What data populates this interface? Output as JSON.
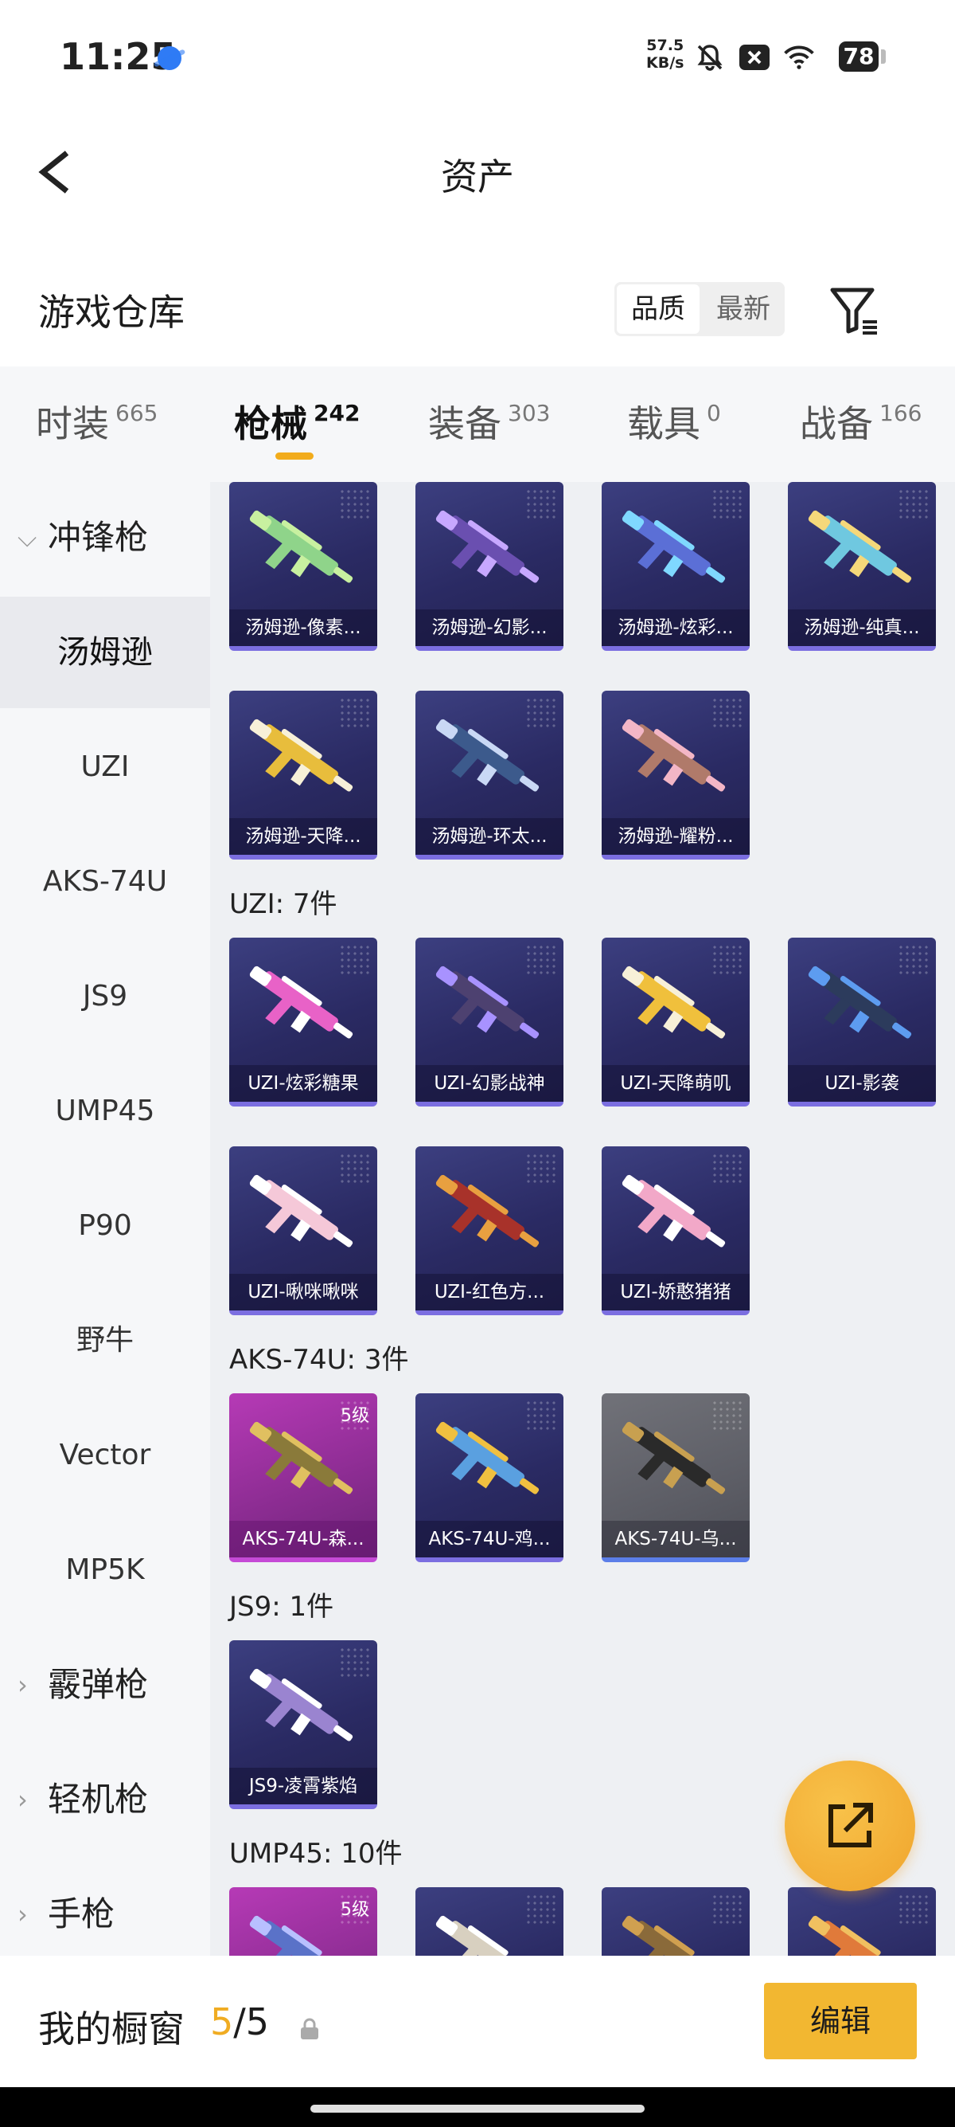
{
  "status_bar": {
    "time": "11:25",
    "speed_value": "57.5",
    "speed_unit": "KB/s",
    "battery": "78"
  },
  "header": {
    "title": "资产"
  },
  "warehouse": {
    "title": "游戏仓库",
    "sort_options": [
      "品质",
      "最新"
    ],
    "sort_selected": "品质"
  },
  "category_tabs": [
    {
      "label": "时装",
      "count": "665"
    },
    {
      "label": "枪械",
      "count": "242",
      "active": true
    },
    {
      "label": "装备",
      "count": "303"
    },
    {
      "label": "载具",
      "count": "0"
    },
    {
      "label": "战备",
      "count": "166"
    }
  ],
  "sidebar": {
    "items": [
      {
        "label": "冲锋枪",
        "type": "group",
        "expanded": true
      },
      {
        "label": "汤姆逊",
        "selected": true
      },
      {
        "label": "UZI"
      },
      {
        "label": "AKS-74U"
      },
      {
        "label": "JS9"
      },
      {
        "label": "UMP45"
      },
      {
        "label": "P90"
      },
      {
        "label": "野牛"
      },
      {
        "label": "Vector"
      },
      {
        "label": "MP5K"
      },
      {
        "label": "霰弹枪",
        "type": "group"
      },
      {
        "label": "轻机枪",
        "type": "group"
      },
      {
        "label": "手枪",
        "type": "group"
      }
    ]
  },
  "groups": {
    "thompson": {
      "items": [
        {
          "name": "汤姆逊-像素...",
          "gun_color": "#8fd48a",
          "accent": "#c8f0a0"
        },
        {
          "name": "汤姆逊-幻影...",
          "gun_color": "#6a4fb0",
          "accent": "#c7a8ff"
        },
        {
          "name": "汤姆逊-炫彩...",
          "gun_color": "#5b6fd6",
          "accent": "#7fd8ff"
        },
        {
          "name": "汤姆逊-纯真...",
          "gun_color": "#6fc8e0",
          "accent": "#f5d87a"
        },
        {
          "name": "汤姆逊-天降...",
          "gun_color": "#e8bd3c",
          "accent": "#f7f0d8"
        },
        {
          "name": "汤姆逊-环太...",
          "gun_color": "#3c5a8c",
          "accent": "#c9d8f5"
        },
        {
          "name": "汤姆逊-耀粉...",
          "gun_color": "#b07a6a",
          "accent": "#f3b6c6"
        }
      ]
    },
    "uzi": {
      "label": "UZI: 7件",
      "items": [
        {
          "name": "UZI-炫彩糖果",
          "gun_color": "#e862c7",
          "accent": "#ffffff"
        },
        {
          "name": "UZI-幻影战神",
          "gun_color": "#4d4170",
          "accent": "#a892ff"
        },
        {
          "name": "UZI-天降萌叽",
          "gun_color": "#f0c03c",
          "accent": "#f7f0d8"
        },
        {
          "name": "UZI-影袭",
          "gun_color": "#2c3b5c",
          "accent": "#5d9cf0"
        },
        {
          "name": "UZI-啾咪啾咪",
          "gun_color": "#f5c8d8",
          "accent": "#ffffff"
        },
        {
          "name": "UZI-红色方...",
          "gun_color": "#a8322a",
          "accent": "#e8a040"
        },
        {
          "name": "UZI-娇憨猪猪",
          "gun_color": "#f2a8c8",
          "accent": "#ffffff"
        }
      ]
    },
    "aks": {
      "label": "AKS-74U: 3件",
      "items": [
        {
          "name": "AKS-74U-森...",
          "gun_color": "#8a7a3a",
          "accent": "#e0c060",
          "style": "pink",
          "level": "5级"
        },
        {
          "name": "AKS-74U-鸡...",
          "gun_color": "#5aa0e0",
          "accent": "#f0c040"
        },
        {
          "name": "AKS-74U-乌...",
          "gun_color": "#2a2a2a",
          "accent": "#c8a050",
          "style": "gray"
        }
      ]
    },
    "js9": {
      "label": "JS9: 1件",
      "items": [
        {
          "name": "JS9-凌霄紫焰",
          "gun_color": "#9a84d0",
          "accent": "#ffffff"
        }
      ]
    },
    "ump45": {
      "label": "UMP45: 10件",
      "items": [
        {
          "name": "",
          "gun_color": "#5a72c8",
          "accent": "#b8c0ff",
          "style": "pink",
          "level": "5级"
        },
        {
          "name": "",
          "gun_color": "#d8d0c0",
          "accent": "#ffffff"
        },
        {
          "name": "",
          "gun_color": "#8a6a3a",
          "accent": "#d0a050"
        },
        {
          "name": "",
          "gun_color": "#e07a3a",
          "accent": "#f0c060"
        }
      ]
    }
  },
  "bottom_bar": {
    "label": "我的橱窗",
    "current": "5",
    "separator": "/",
    "total": "5",
    "edit_label": "编辑"
  },
  "colors": {
    "accent": "#f2ac1c",
    "card_rare": "#2a2a63",
    "card_epic": "#8e2d94"
  }
}
